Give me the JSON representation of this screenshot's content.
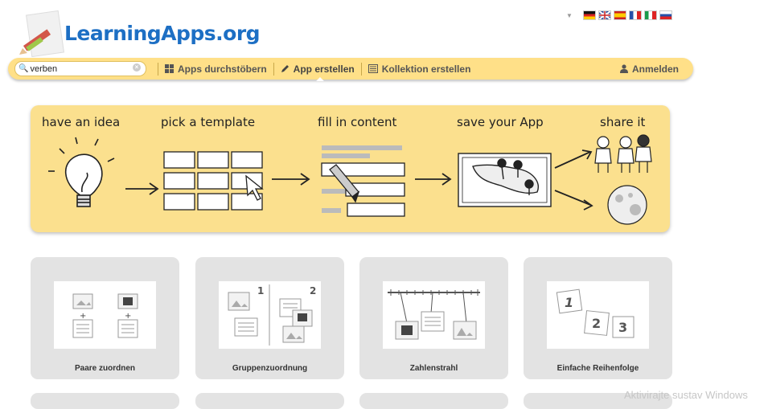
{
  "header": {
    "logo_text": "LearningApps.org"
  },
  "languages": [
    "German",
    "English",
    "Spanish",
    "French",
    "Italian",
    "Russian"
  ],
  "toolbar": {
    "search_value": "verben",
    "items": [
      {
        "label": "Apps durchstöbern",
        "icon": "grid-icon"
      },
      {
        "label": "App erstellen",
        "icon": "pencil-icon"
      },
      {
        "label": "Kollektion erstellen",
        "icon": "collection-icon"
      }
    ],
    "login_label": "Anmelden"
  },
  "banner": {
    "steps": [
      "have an idea",
      "pick a template",
      "fill in content",
      "save your App",
      "share it"
    ]
  },
  "templates": [
    {
      "label": "Paare zuordnen"
    },
    {
      "label": "Gruppenzuordnung"
    },
    {
      "label": "Zahlenstrahl"
    },
    {
      "label": "Einfache Reihenfolge"
    }
  ],
  "watermark": "Aktivirajte sustav Windows",
  "colors": {
    "accent": "#ffe088",
    "banner": "#fbe08e",
    "logo": "#1d6fc4",
    "card": "#e3e3e3"
  }
}
